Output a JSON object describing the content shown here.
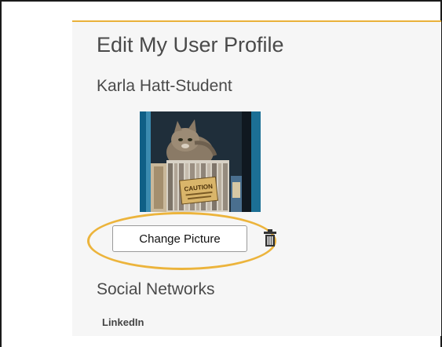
{
  "profile": {
    "page_title": "Edit My User Profile",
    "user_name": "Karla Hatt-Student",
    "avatar_sign_text": "CAUTION",
    "change_picture_label": "Change Picture",
    "delete_icon": "trash-icon"
  },
  "social": {
    "title": "Social Networks",
    "linkedin_label": "LinkedIn"
  },
  "colors": {
    "accent": "#eab13a",
    "panel_bg": "#f6f6f6",
    "text": "#4a4a4a"
  }
}
